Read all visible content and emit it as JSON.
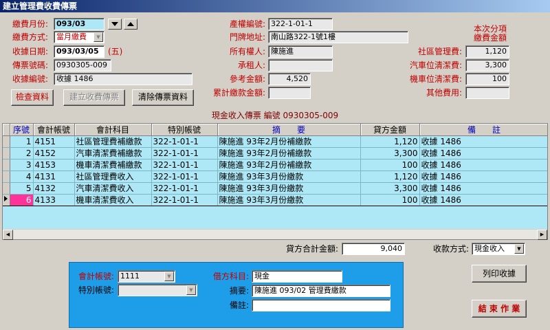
{
  "window": {
    "title": "建立管理費收費傳票"
  },
  "form": {
    "fee_month": {
      "label": "繳費月份:",
      "value": "093/03"
    },
    "fee_method": {
      "label": "繳費方式:",
      "value": "當月繳費"
    },
    "receipt_date": {
      "label": "收據日期:",
      "value": "093/03/05",
      "weekday": "(五)"
    },
    "voucher_no": {
      "label": "傳票號碼:",
      "value": "0930305-009"
    },
    "receipt_no": {
      "label": "收據編號:",
      "value": "收據 1486"
    },
    "property_no": {
      "label": "產權編號:",
      "value": "322-1-01-1"
    },
    "address": {
      "label": "門牌地址:",
      "value": "南山路322-1號1樓"
    },
    "owner": {
      "label": "所有權人:",
      "value": "陳施進"
    },
    "tenant": {
      "label": "承租人:",
      "value": ""
    },
    "ref_amount": {
      "label": "參考金額:",
      "value": "4,520"
    },
    "accum_amount": {
      "label": "累計繳款金額:",
      "value": ""
    }
  },
  "fees": {
    "header_line1": "本次分項",
    "header_line2": "繳費金額",
    "items": [
      {
        "label": "社區管理費:",
        "value": "1,120"
      },
      {
        "label": "汽車位清潔費:",
        "value": "3,300"
      },
      {
        "label": "機車位清潔費:",
        "value": "100"
      },
      {
        "label": "其他費用:",
        "value": ""
      }
    ]
  },
  "buttons": {
    "check": "檢查資料",
    "create": "建立收費傳票",
    "clear": "清除傳票資料",
    "print": "列印收據",
    "end": "結 束 作 業"
  },
  "voucher_caption": "現金收入傳票 編號 0930305-009",
  "grid": {
    "headers": [
      "序號",
      "會計帳號",
      "會計科目",
      "特別帳號",
      "摘　　要",
      "貸方金額",
      "備　　註"
    ],
    "rows": [
      {
        "seq": "1",
        "acct": "4151",
        "subject": "社區管理費補繳款",
        "special": "322-1-01-1",
        "summary": "陳施進  93年2月份補繳款",
        "credit": "1,120",
        "note": "收據  1486"
      },
      {
        "seq": "2",
        "acct": "4152",
        "subject": "汽車清潔費補繳款",
        "special": "322-1-01-1",
        "summary": "陳施進  93年2月份補繳款",
        "credit": "3,300",
        "note": "收據  1486"
      },
      {
        "seq": "3",
        "acct": "4153",
        "subject": "機車清潔費補繳款",
        "special": "322-1-01-1",
        "summary": "陳施進  93年2月份補繳款",
        "credit": "100",
        "note": "收據  1486"
      },
      {
        "seq": "4",
        "acct": "4131",
        "subject": "社區管理費收入",
        "special": "322-1-01-1",
        "summary": "陳施進  93年3月份繳款",
        "credit": "1,120",
        "note": "收據  1486"
      },
      {
        "seq": "5",
        "acct": "4132",
        "subject": "汽車清潔費收入",
        "special": "322-1-01-1",
        "summary": "陳施進  93年3月份繳款",
        "credit": "3,300",
        "note": "收據  1486"
      },
      {
        "seq": "6",
        "acct": "4133",
        "subject": "機車清潔費收入",
        "special": "322-1-01-1",
        "summary": "陳施進  93年3月份繳款",
        "credit": "100",
        "note": "收據  1486"
      }
    ]
  },
  "totals": {
    "credit_label": "貸方合計金額:",
    "credit_value": "9,040",
    "payment_label": "收款方式:",
    "payment_value": "現金收入"
  },
  "panel": {
    "acct_label": "會計帳號:",
    "acct_value": "1111",
    "special_label": "特別帳號:",
    "special_value": "",
    "debit_label": "借方科目:",
    "debit_value": "現金",
    "summary_label": "摘要:",
    "summary_value": "陳施進 093/02 管理費繳款",
    "note_label": "備註:",
    "note_value": ""
  }
}
